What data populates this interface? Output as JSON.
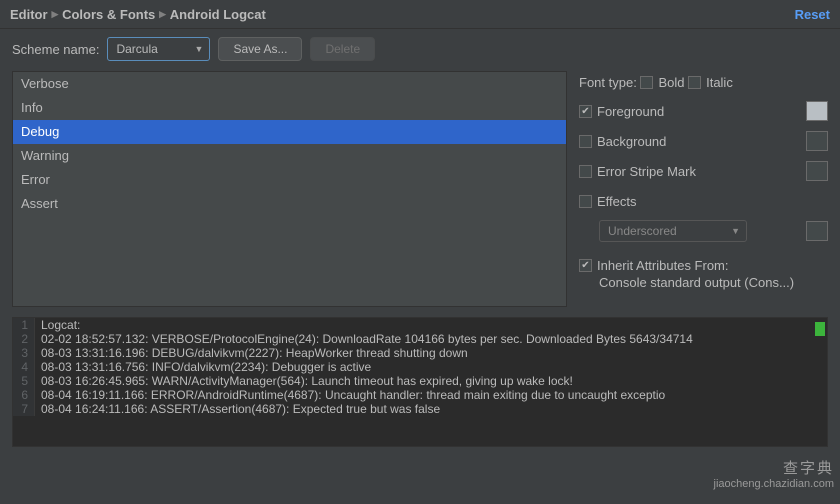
{
  "breadcrumb": [
    "Editor",
    "Colors & Fonts",
    "Android Logcat"
  ],
  "reset_label": "Reset",
  "scheme": {
    "label": "Scheme name:",
    "value": "Darcula"
  },
  "buttons": {
    "save_as": "Save As...",
    "delete": "Delete"
  },
  "log_levels": [
    "Verbose",
    "Info",
    "Debug",
    "Warning",
    "Error",
    "Assert"
  ],
  "selected_level_index": 2,
  "font_type": {
    "label": "Font type:",
    "bold": "Bold",
    "italic": "Italic",
    "bold_checked": false,
    "italic_checked": false
  },
  "options": {
    "foreground": {
      "label": "Foreground",
      "checked": true
    },
    "background": {
      "label": "Background",
      "checked": false
    },
    "error_stripe": {
      "label": "Error Stripe Mark",
      "checked": false
    },
    "effects": {
      "label": "Effects",
      "checked": false,
      "value": "Underscored"
    }
  },
  "inherit": {
    "checked": true,
    "label": "Inherit Attributes From:",
    "source": "Console standard output (Cons...)"
  },
  "preview": {
    "header": "Logcat:",
    "lines": [
      {
        "n": 1,
        "cls": "",
        "t": "Logcat:"
      },
      {
        "n": 2,
        "cls": "c-verbose",
        "t": "02-02 18:52:57.132: VERBOSE/ProtocolEngine(24): DownloadRate 104166 bytes per sec. Downloaded Bytes 5643/34714"
      },
      {
        "n": 3,
        "cls": "c-debug",
        "t": "08-03 13:31:16.196: DEBUG/dalvikvm(2227): HeapWorker thread shutting down"
      },
      {
        "n": 4,
        "cls": "c-info",
        "t": "08-03 13:31:16.756: INFO/dalvikvm(2234): Debugger is active"
      },
      {
        "n": 5,
        "cls": "c-warn",
        "t": "08-03 16:26:45.965: WARN/ActivityManager(564): Launch timeout has expired, giving up wake lock!"
      },
      {
        "n": 6,
        "cls": "c-error",
        "t": "08-04 16:19:11.166: ERROR/AndroidRuntime(4687): Uncaught handler: thread main exiting due to uncaught exceptio"
      },
      {
        "n": 7,
        "cls": "c-assert",
        "t": "08-04 16:24:11.166: ASSERT/Assertion(4687): Expected true but was false"
      }
    ]
  },
  "watermark": {
    "l1": "查字典",
    "l2": "jiaocheng.chazidian.com"
  }
}
